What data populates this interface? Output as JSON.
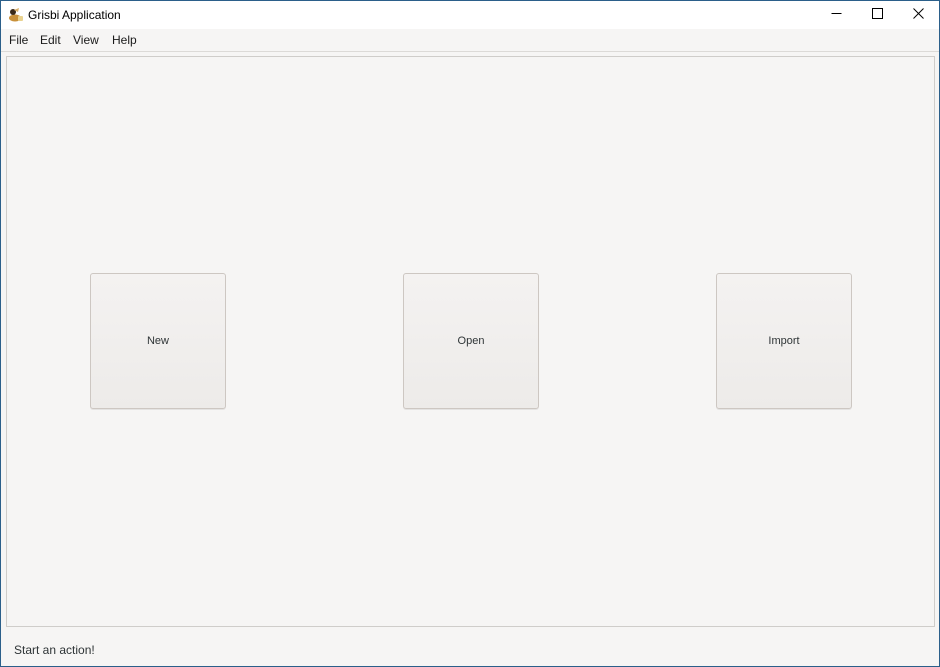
{
  "window": {
    "title": "Grisbi Application",
    "icon": "grisbi-app-icon",
    "controls": {
      "minimize_icon": "minimize-icon",
      "maximize_icon": "maximize-icon",
      "close_icon": "close-icon"
    }
  },
  "menubar": {
    "items": [
      {
        "label": "File"
      },
      {
        "label": "Edit"
      },
      {
        "label": "View"
      },
      {
        "label": "Help"
      }
    ]
  },
  "main": {
    "buttons": {
      "new_label": "New",
      "open_label": "Open",
      "import_label": "Import"
    }
  },
  "status": {
    "text": "Start an action!"
  },
  "colors": {
    "window_border": "#2b5f8a",
    "background": "#f6f5f4",
    "text": "#2e3436"
  }
}
